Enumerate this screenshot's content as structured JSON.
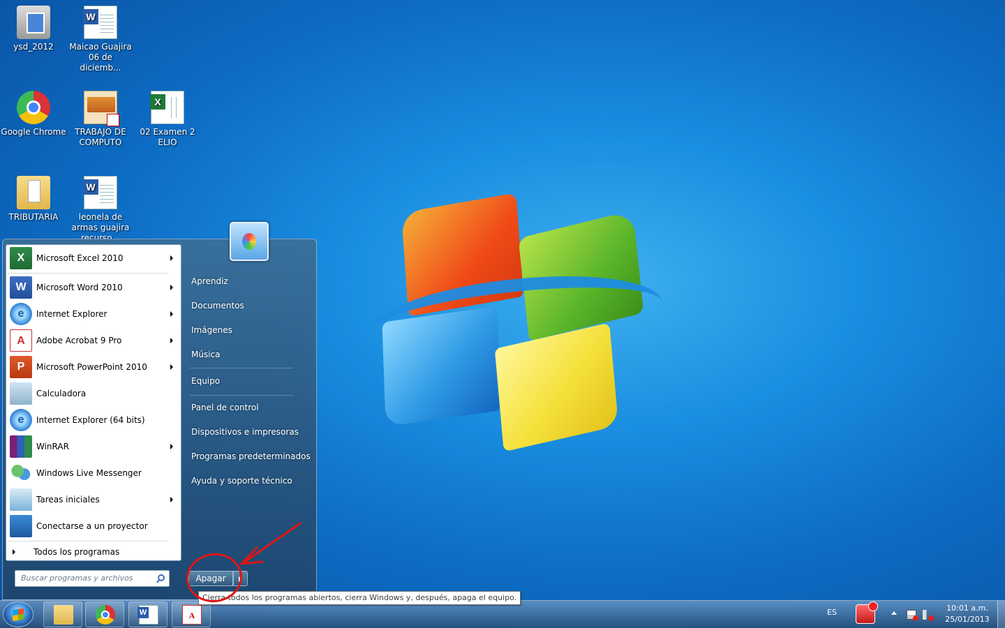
{
  "desktop": {
    "icons": [
      {
        "label": "ysd_2012",
        "icon": "installer-icon"
      },
      {
        "label": "Maicao Guajira 06 de diciemb...",
        "icon": "word-document-icon"
      },
      {
        "label": "Google Chrome",
        "icon": "chrome-icon"
      },
      {
        "label": "TRABAJO DE COMPUTO",
        "icon": "pdf-document-icon"
      },
      {
        "label": "02 Examen 2 ELIO",
        "icon": "excel-document-icon"
      },
      {
        "label": "TRIBUTARIA",
        "icon": "folder-icon"
      },
      {
        "label": "leonela de armas guajira recurso...",
        "icon": "word-document-icon"
      }
    ]
  },
  "start_menu": {
    "pinned_programs": [
      {
        "label": "Microsoft Excel 2010",
        "has_submenu": true,
        "icon": "excel-icon"
      },
      {
        "label": "Microsoft Word 2010",
        "has_submenu": true,
        "icon": "word-icon"
      },
      {
        "label": "Internet Explorer",
        "has_submenu": true,
        "icon": "ie-icon"
      },
      {
        "label": "Adobe Acrobat 9 Pro",
        "has_submenu": true,
        "icon": "acrobat-icon"
      },
      {
        "label": "Microsoft PowerPoint 2010",
        "has_submenu": true,
        "icon": "powerpoint-icon"
      },
      {
        "label": "Calculadora",
        "has_submenu": false,
        "icon": "calculator-icon"
      },
      {
        "label": "Internet Explorer (64 bits)",
        "has_submenu": false,
        "icon": "ie-icon"
      },
      {
        "label": "WinRAR",
        "has_submenu": true,
        "icon": "winrar-icon"
      },
      {
        "label": "Windows Live Messenger",
        "has_submenu": false,
        "icon": "messenger-icon"
      },
      {
        "label": "Tareas iniciales",
        "has_submenu": true,
        "icon": "getting-started-icon"
      },
      {
        "label": "Conectarse a un proyector",
        "has_submenu": false,
        "icon": "projector-icon"
      }
    ],
    "all_programs_label": "Todos los programas",
    "search_placeholder": "Buscar programas y archivos",
    "right_items": [
      "Aprendiz",
      "Documentos",
      "Imágenes",
      "Música",
      "Equipo",
      "Panel de control",
      "Dispositivos e impresoras",
      "Programas predeterminados",
      "Ayuda y soporte técnico"
    ],
    "shutdown_label": "Apagar",
    "shutdown_tooltip": "Cierra todos los programas abiertos, cierra Windows y, después, apaga el equipo."
  },
  "taskbar": {
    "pinned": [
      "windows-explorer-icon",
      "chrome-icon",
      "word-icon",
      "acrobat-icon"
    ],
    "language": "ES",
    "time": "10:01 a.m.",
    "date": "25/01/2013"
  },
  "colors": {
    "annotation": "#e01515",
    "accent": "#0d6cc4"
  }
}
